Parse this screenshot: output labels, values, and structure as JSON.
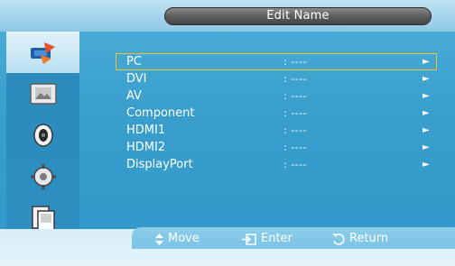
{
  "header": {
    "title": "Edit Name"
  },
  "sidebar": {
    "icons": [
      {
        "name": "input-icon",
        "active": true
      },
      {
        "name": "picture-icon",
        "active": false
      },
      {
        "name": "sound-icon",
        "active": false
      },
      {
        "name": "setup-icon",
        "active": false
      },
      {
        "name": "multi-control-icon",
        "active": false
      }
    ]
  },
  "menu": {
    "items": [
      {
        "label": "PC",
        "value": ": ----",
        "selected": true
      },
      {
        "label": "DVI",
        "value": ": ----",
        "selected": false
      },
      {
        "label": "AV",
        "value": ": ----",
        "selected": false
      },
      {
        "label": "Component",
        "value": ": ----",
        "selected": false
      },
      {
        "label": "HDMI1",
        "value": ": ----",
        "selected": false
      },
      {
        "label": "HDMI2",
        "value": ": ----",
        "selected": false
      },
      {
        "label": "DisplayPort",
        "value": ": ----",
        "selected": false
      }
    ],
    "arrow": "►"
  },
  "footer": {
    "move_label": "Move",
    "enter_label": "Enter",
    "return_label": "Return"
  },
  "colors": {
    "panel": "#3a9fcd",
    "title_pill": "#5a5a5a",
    "selection": "#f0c22e"
  }
}
